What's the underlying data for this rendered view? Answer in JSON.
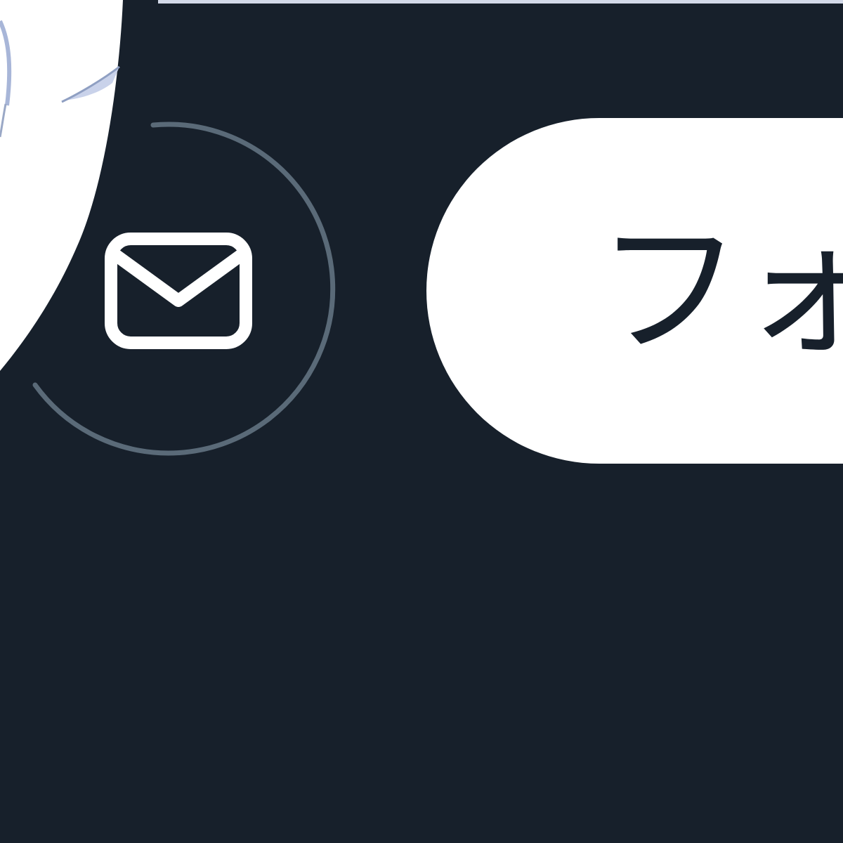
{
  "colors": {
    "background": "#17202b",
    "top_strip": "#d3d9e8",
    "button_background": "#ffffff",
    "button_text": "#17202b",
    "ring": "#5a6a78",
    "icon": "#ffffff"
  },
  "avatar": {
    "icon": "avatar-image"
  },
  "message_button": {
    "icon": "mail-icon"
  },
  "follow_button": {
    "label": "フォ"
  }
}
